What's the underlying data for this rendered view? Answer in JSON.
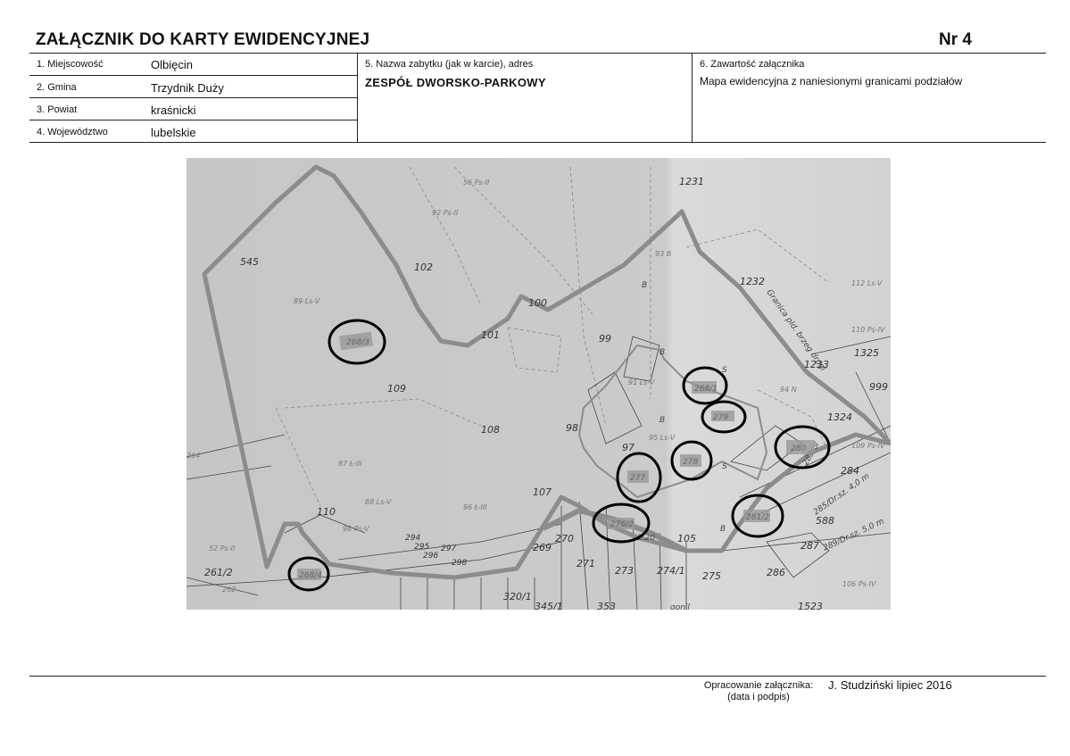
{
  "header": {
    "title": "ZAŁĄCZNIK DO KARTY EWIDENCYJNEJ",
    "number": "Nr 4"
  },
  "fields": [
    {
      "label": "1. Miejscowość",
      "value": "Olbięcin"
    },
    {
      "label": "2. Gmina",
      "value": "Trzydnik Duży"
    },
    {
      "label": "3. Powiat",
      "value": "kraśnicki"
    },
    {
      "label": "4. Województwo",
      "value": "lubelskie"
    }
  ],
  "monument": {
    "label": "5. Nazwa zabytku (jak w karcie), adres",
    "value": "ZESPÓŁ DWORSKO-PARKOWY"
  },
  "contents": {
    "label": "6. Zawartość załącznika",
    "value": "Mapa ewidencyjna z naniesionymi granicami podziałów"
  },
  "map": {
    "parcel_labels": [
      "545",
      "102",
      "100",
      "101",
      "99",
      "109",
      "108",
      "98",
      "97",
      "107",
      "110",
      "105",
      "1232",
      "1233",
      "1325",
      "1324",
      "999",
      "1231",
      "284",
      "588",
      "287",
      "286",
      "275",
      "274/1",
      "273",
      "271",
      "270",
      "269",
      "294",
      "295",
      "296",
      "297",
      "298",
      "261/2",
      "320/1",
      "345/1",
      "353",
      "1523"
    ],
    "land_class_labels": [
      "89 Ls-V",
      "92 Ps-II",
      "56 Ps-II",
      "87 Ł-III",
      "88 Ls-V",
      "96 Ł-III",
      "98 Ps-V",
      "95 Ls-V",
      "91 Ls-V",
      "94 N",
      "93 B",
      "264",
      "52 Ps-II",
      "112 Ls-V",
      "110 Ps-IV",
      "109 Ps-IV",
      "106 Ps-IV",
      "262"
    ],
    "circled_parcels": [
      "268/3",
      "268/1",
      "279",
      "278",
      "277",
      "280",
      "281/2",
      "276/2",
      "268/4"
    ],
    "boundary_note": "Granica pld. brzeg drogi",
    "misc_labels": [
      "B",
      "B",
      "B",
      "B",
      "S",
      "S",
      "283/ol",
      "285/Dr.sz. 4,0 m",
      "289/Dr.sz. 5,0 m",
      "2.20",
      "gonil"
    ]
  },
  "footer": {
    "label_line1": "Opracowanie załącznika:",
    "label_line2": "(data i podpis)",
    "value": "J. Studziński lipiec 2016"
  }
}
